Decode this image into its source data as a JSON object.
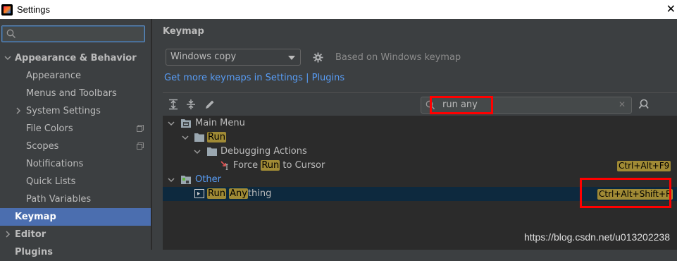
{
  "window": {
    "title": "Settings"
  },
  "sidebar": {
    "search_placeholder": "",
    "items": [
      {
        "label": "Appearance & Behavior",
        "level": 0,
        "expanded": true,
        "bold": true
      },
      {
        "label": "Appearance",
        "level": 1
      },
      {
        "label": "Menus and Toolbars",
        "level": 1
      },
      {
        "label": "System Settings",
        "level": 1,
        "expandable": true
      },
      {
        "label": "File Colors",
        "level": 1,
        "project_icon": true
      },
      {
        "label": "Scopes",
        "level": 1,
        "project_icon": true
      },
      {
        "label": "Notifications",
        "level": 1
      },
      {
        "label": "Quick Lists",
        "level": 1
      },
      {
        "label": "Path Variables",
        "level": 1
      },
      {
        "label": "Keymap",
        "level": 0,
        "selected": true,
        "bold": true
      },
      {
        "label": "Editor",
        "level": 0,
        "expandable": true,
        "bold": true
      },
      {
        "label": "Plugins",
        "level": 0,
        "bold": true
      }
    ]
  },
  "main": {
    "title": "Keymap",
    "keymap_select": "Windows copy",
    "based_on": "Based on Windows keymap",
    "links": "Get more keymaps in Settings | Plugins",
    "filter_value": "run any",
    "tree": [
      {
        "pre": "",
        "hl": "",
        "post": "Main Menu",
        "level": 0
      },
      {
        "pre": "",
        "hl": "Run",
        "post": "",
        "level": 1
      },
      {
        "pre": "",
        "hl": "",
        "post": "Debugging Actions",
        "level": 2
      },
      {
        "pre": "Force ",
        "hl": "Run",
        "post": " to Cursor",
        "level": 3,
        "shortcut": "Ctrl+Alt+F9"
      },
      {
        "pre": "",
        "hl": "",
        "post": "Other",
        "level": 0
      },
      {
        "pre": "",
        "hl": "Run",
        "mid": " ",
        "hl2": "Any",
        "post": "thing",
        "level": 1,
        "shortcut": "Ctrl+Alt+Shift+R",
        "selected": true
      }
    ]
  },
  "watermark": "https://blog.csdn.net/u013202238",
  "colors": {
    "accent": "#4b6eaf",
    "highlight": "#a08a35",
    "link": "#589df6",
    "annotation": "#ff0000"
  }
}
